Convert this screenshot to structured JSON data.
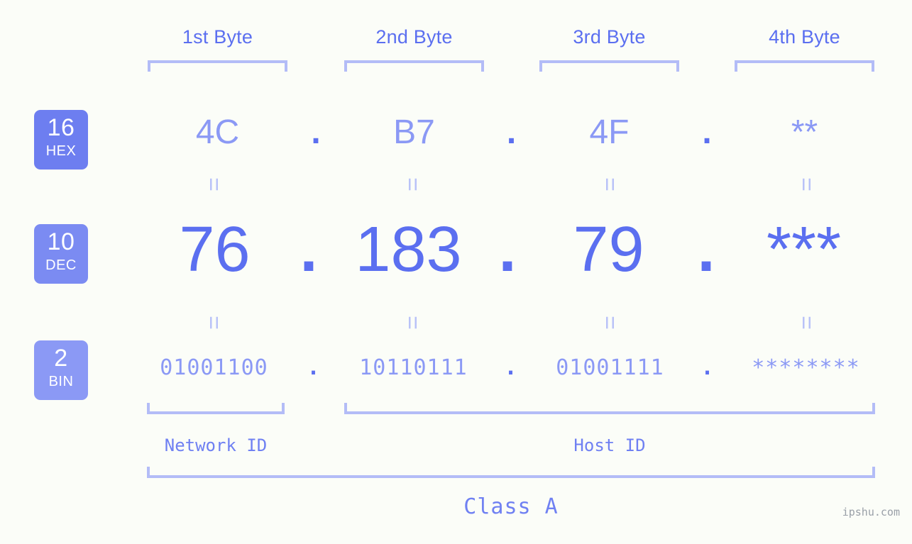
{
  "header": {
    "byte_labels": [
      "1st Byte",
      "2nd Byte",
      "3rd Byte",
      "4th Byte"
    ]
  },
  "bases": [
    {
      "num": "16",
      "name": "HEX"
    },
    {
      "num": "10",
      "name": "DEC"
    },
    {
      "num": "2",
      "name": "BIN"
    }
  ],
  "rows": {
    "hex": {
      "values": [
        "4C",
        "B7",
        "4F",
        "**"
      ],
      "separator": "."
    },
    "dec": {
      "values": [
        "76",
        "183",
        "79",
        "***"
      ],
      "separator": "."
    },
    "bin": {
      "values": [
        "01001100",
        "10110111",
        "01001111",
        "********"
      ],
      "separator": "."
    }
  },
  "connectors": {
    "symbol": "="
  },
  "sections": {
    "network_id": "Network ID",
    "host_id": "Host ID",
    "class": "Class A"
  },
  "watermark": "ipshu.com",
  "colors": {
    "background": "#fbfdf8",
    "accent_strong": "#5b6ff0",
    "accent_mid": "#8b99f5",
    "accent_light": "#b3bcf7",
    "badge_hex": "#6d7ef0",
    "badge_dec": "#7b8bf2",
    "badge_bin": "#8b99f5",
    "watermark": "#9aa0a8"
  }
}
